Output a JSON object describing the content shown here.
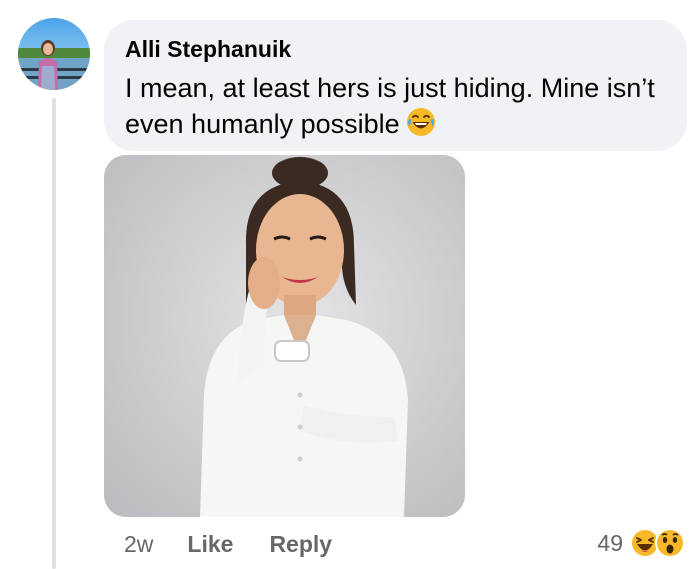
{
  "comment": {
    "author": "Alli Stephanuik",
    "text": "I mean, at least hers is just hiding. Mine isn’t even humanly possible",
    "emoji": "tears-of-joy-emoji",
    "attachment": "photo"
  },
  "actions": {
    "time": "2w",
    "like_label": "Like",
    "reply_label": "Reply"
  },
  "reactions": {
    "count": "49",
    "types": [
      "haha-reaction-icon",
      "wow-reaction-icon"
    ]
  },
  "colors": {
    "bubble_bg": "#f0f2f5",
    "text": "#050505",
    "secondary_text": "#65676b",
    "reaction_yellow": "#f7b928"
  }
}
